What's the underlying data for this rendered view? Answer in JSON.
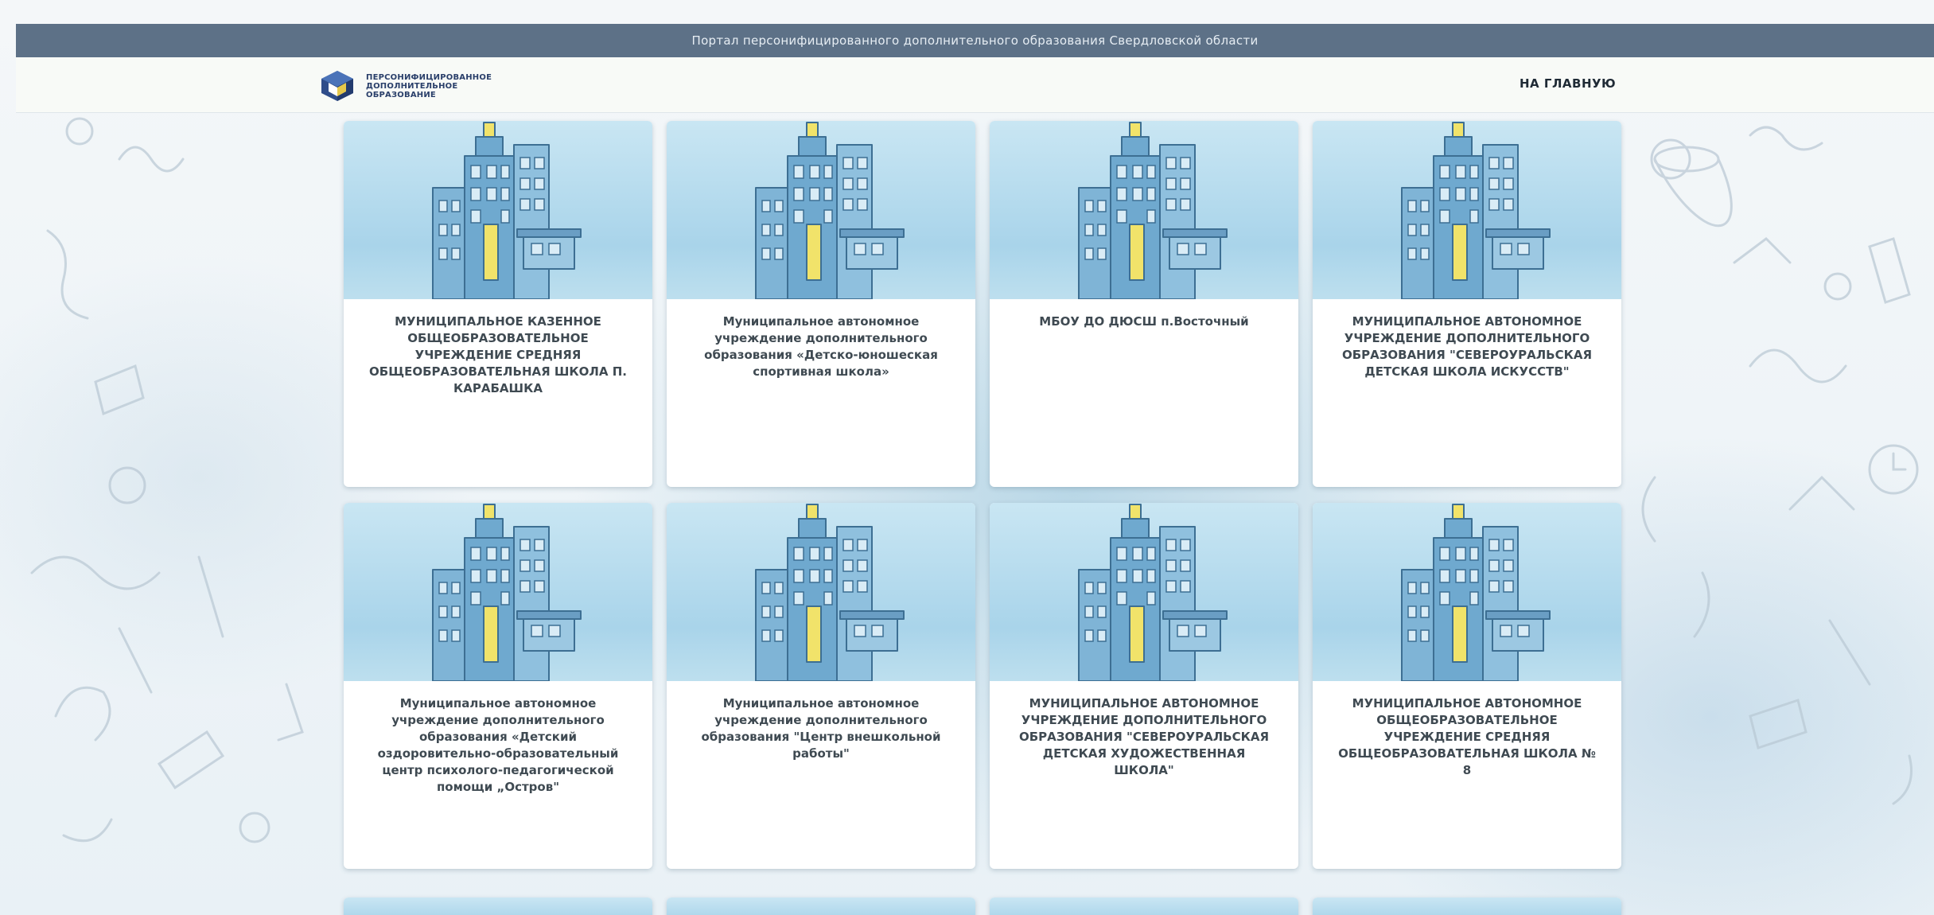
{
  "topbar": {
    "title": "Портал персонифицированного дополнительного образования Свердловской области"
  },
  "header": {
    "logo_text": "Персонифицированное дополнительное образование",
    "nav_home": "НА ГЛАВНУЮ"
  },
  "cards": [
    {
      "title": "МУНИЦИПАЛЬНОЕ КАЗЕННОЕ ОБЩЕОБРАЗОВАТЕЛЬНОЕ УЧРЕЖДЕНИЕ СРЕДНЯЯ ОБЩЕОБРАЗОВАТЕЛЬНАЯ ШКОЛА П. КАРАБАШКА"
    },
    {
      "title": "Муниципальное автономное учреждение дополнительного образования «Детско-юношеская спортивная школа»"
    },
    {
      "title": "МБОУ ДО ДЮСШ п.Восточный"
    },
    {
      "title": "МУНИЦИПАЛЬНОЕ АВТОНОМНОЕ УЧРЕЖДЕНИЕ ДОПОЛНИТЕЛЬНОГО ОБРАЗОВАНИЯ \"СЕВЕРОУРАЛЬСКАЯ ДЕТСКАЯ ШКОЛА ИСКУССТВ\""
    },
    {
      "title": "Муниципальное автономное учреждение дополнительного образования «Детский оздоровительно-образовательный центр психолого-педагогической помощи „Остров\""
    },
    {
      "title": "Муниципальное автономное учреждение дополнительного образования \"Центр внешкольной работы\""
    },
    {
      "title": "МУНИЦИПАЛЬНОЕ АВТОНОМНОЕ УЧРЕЖДЕНИЕ ДОПОЛНИТЕЛЬНОГО ОБРАЗОВАНИЯ \"СЕВЕРОУРАЛЬСКАЯ ДЕТСКАЯ ХУДОЖЕСТВЕННАЯ ШКОЛА\""
    },
    {
      "title": "МУНИЦИПАЛЬНОЕ АВТОНОМНОЕ ОБЩЕОБРАЗОВАТЕЛЬНОЕ УЧРЕЖДЕНИЕ СРЕДНЯЯ ОБЩЕОБРАЗОВАТЕЛЬНАЯ ШКОЛА № 8"
    }
  ],
  "theme": {
    "topbar_color": "#5d7187",
    "card_title_color": "#3f4a52",
    "building_color": "#6fa9cf",
    "accent_yellow": "#f1e36a"
  },
  "icons": {
    "logo": "cube-logo-icon",
    "card_image": "building-illustration"
  }
}
